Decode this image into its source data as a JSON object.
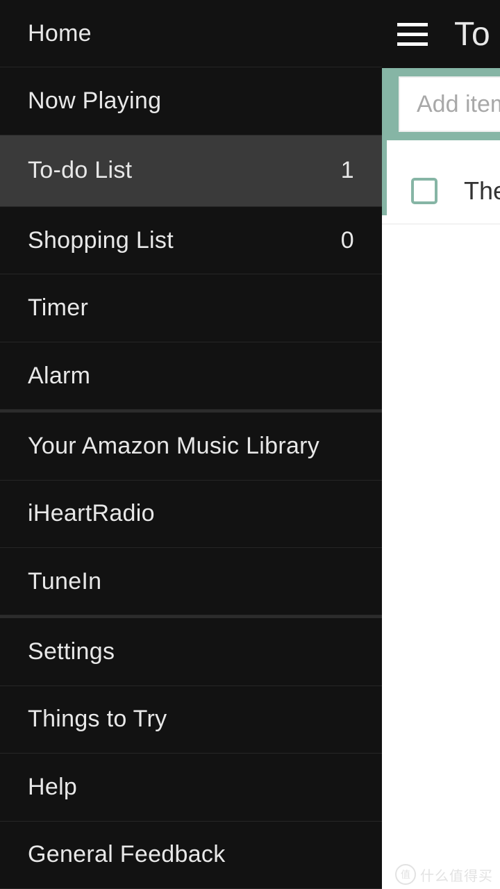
{
  "sidebar": {
    "items": [
      {
        "label": "Home",
        "badge": null,
        "active": false
      },
      {
        "label": "Now Playing",
        "badge": null,
        "active": false
      },
      {
        "label": "To-do List",
        "badge": "1",
        "active": true
      },
      {
        "label": "Shopping List",
        "badge": "0",
        "active": false
      },
      {
        "label": "Timer",
        "badge": null,
        "active": false
      },
      {
        "label": "Alarm",
        "badge": null,
        "active": false
      }
    ],
    "section2": [
      {
        "label": "Your Amazon Music Library"
      },
      {
        "label": "iHeartRadio"
      },
      {
        "label": "TuneIn"
      }
    ],
    "section3": [
      {
        "label": "Settings"
      },
      {
        "label": "Things to Try"
      },
      {
        "label": "Help"
      },
      {
        "label": "General Feedback"
      }
    ]
  },
  "header": {
    "title": "To"
  },
  "input": {
    "placeholder": "Add item"
  },
  "list": {
    "items": [
      {
        "text": "The"
      }
    ]
  },
  "watermark": {
    "badge": "值",
    "text": "什么值得买"
  }
}
